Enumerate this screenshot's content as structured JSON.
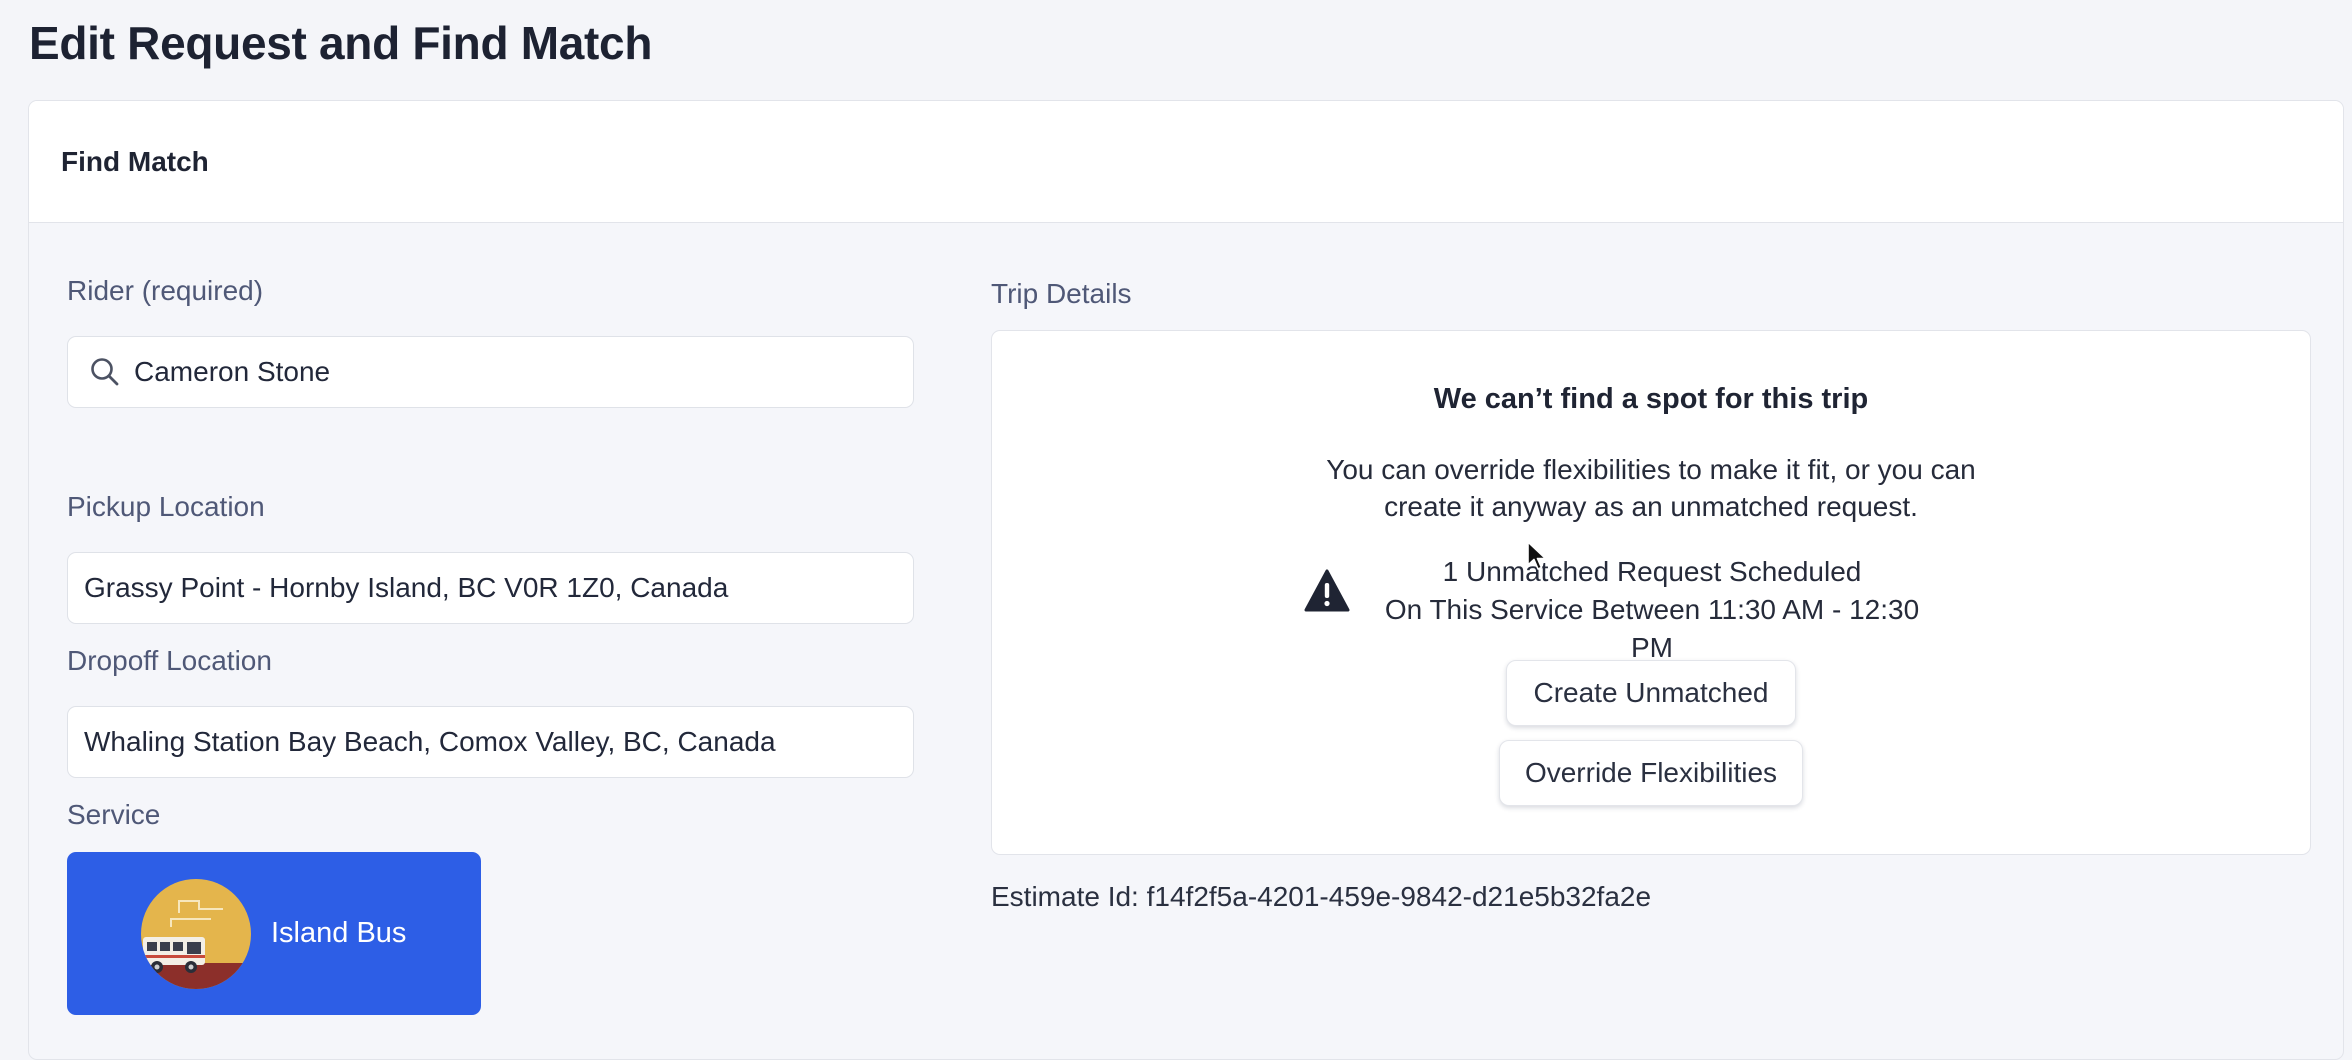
{
  "page": {
    "title": "Edit Request and Find Match"
  },
  "card": {
    "header_title": "Find Match"
  },
  "form": {
    "rider_label": "Rider (required)",
    "rider_value": "Cameron Stone",
    "pickup_label": "Pickup Location",
    "pickup_value": "Grassy Point - Hornby Island, BC V0R 1Z0, Canada",
    "dropoff_label": "Dropoff Location",
    "dropoff_value": "Whaling Station Bay Beach, Comox Valley, BC, Canada",
    "service_label": "Service",
    "service_name": "Island Bus"
  },
  "trip": {
    "label": "Trip Details",
    "title": "We can’t find a spot for this trip",
    "body_line1": "You can override flexibilities to make it fit, or you can",
    "body_line2": "create it anyway as an unmatched request.",
    "warning_line1": "1 Unmatched Request Scheduled",
    "warning_line2": "On This Service Between 11:30 AM - 12:30 PM",
    "create_unmatched_label": "Create Unmatched",
    "override_label": "Override Flexibilities"
  },
  "estimate": {
    "text": "Estimate Id: f14f2f5a-4201-459e-9842-d21e5b32fa2e"
  },
  "icons": {
    "search": "search-icon",
    "warning": "warning-triangle-icon",
    "service_avatar": "bus-icon",
    "cursor": "mouse-cursor-icon"
  },
  "colors": {
    "accent": "#2d5ee6",
    "page_background": "#f4f5f9",
    "card_background": "#ffffff",
    "label_text": "#4f5877"
  }
}
